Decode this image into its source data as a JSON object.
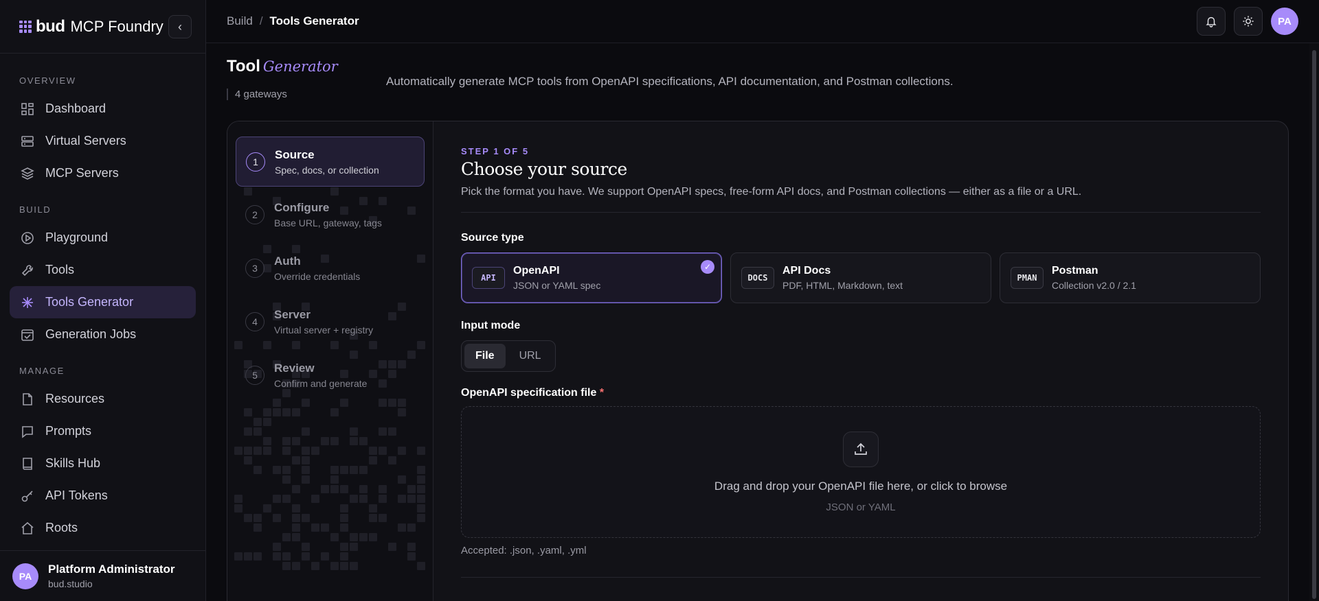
{
  "brand": {
    "bud": "bud",
    "name": "MCP Foundry"
  },
  "sidebar": {
    "sections": [
      {
        "title": "OVERVIEW"
      },
      {
        "title": "BUILD"
      },
      {
        "title": "MANAGE"
      }
    ],
    "overview": [
      {
        "label": "Dashboard",
        "icon": "dashboard-icon"
      },
      {
        "label": "Virtual Servers",
        "icon": "server-icon"
      },
      {
        "label": "MCP Servers",
        "icon": "layers-icon"
      }
    ],
    "build": [
      {
        "label": "Playground",
        "icon": "play-icon"
      },
      {
        "label": "Tools",
        "icon": "wrench-icon"
      },
      {
        "label": "Tools Generator",
        "icon": "sparkle-icon",
        "active": true
      },
      {
        "label": "Generation Jobs",
        "icon": "calendar-check-icon"
      }
    ],
    "manage": [
      {
        "label": "Resources",
        "icon": "file-icon"
      },
      {
        "label": "Prompts",
        "icon": "message-icon"
      },
      {
        "label": "Skills Hub",
        "icon": "book-icon"
      },
      {
        "label": "API Tokens",
        "icon": "key-icon"
      },
      {
        "label": "Roots",
        "icon": "home-icon"
      }
    ],
    "user": {
      "initials": "PA",
      "name": "Platform Administrator",
      "org": "bud.studio"
    }
  },
  "topbar": {
    "crumb_build": "Build",
    "crumb_sep": "/",
    "crumb_current": "Tools Generator",
    "avatar": "PA"
  },
  "header": {
    "title": "Tool",
    "title_accent": "Generator",
    "gateways": "4 gateways",
    "subtitle": "Automatically generate MCP tools from OpenAPI specifications, API documentation, and Postman collections."
  },
  "steps": [
    {
      "num": "1",
      "title": "Source",
      "sub": "Spec, docs, or collection",
      "active": true
    },
    {
      "num": "2",
      "title": "Configure",
      "sub": "Base URL, gateway, tags"
    },
    {
      "num": "3",
      "title": "Auth",
      "sub": "Override credentials"
    },
    {
      "num": "4",
      "title": "Server",
      "sub": "Virtual server + registry"
    },
    {
      "num": "5",
      "title": "Review",
      "sub": "Confirm and generate"
    }
  ],
  "content": {
    "step_label": "STEP 1 OF 5",
    "heading": "Choose your source",
    "description": "Pick the format you have. We support OpenAPI specs, free-form API docs, and Postman collections — either as a file or a URL.",
    "source_type_label": "Source type",
    "cards": [
      {
        "tag": "API",
        "title": "OpenAPI",
        "sub": "JSON or YAML spec",
        "selected": true
      },
      {
        "tag": "DOCS",
        "title": "API Docs",
        "sub": "PDF, HTML, Markdown, text"
      },
      {
        "tag": "PMAN",
        "title": "Postman",
        "sub": "Collection v2.0 / 2.1"
      }
    ],
    "input_mode_label": "Input mode",
    "modes": {
      "file": "File",
      "url": "URL"
    },
    "file_label": "OpenAPI specification file",
    "required_mark": "*",
    "drop_text": "Drag and drop your OpenAPI file here, or click to browse",
    "drop_sub": "JSON or YAML",
    "accepted": "Accepted: .json, .yaml, .yml"
  },
  "colors": {
    "accent": "#a78bfa",
    "background": "#0b0b0f",
    "required": "#f87171"
  }
}
